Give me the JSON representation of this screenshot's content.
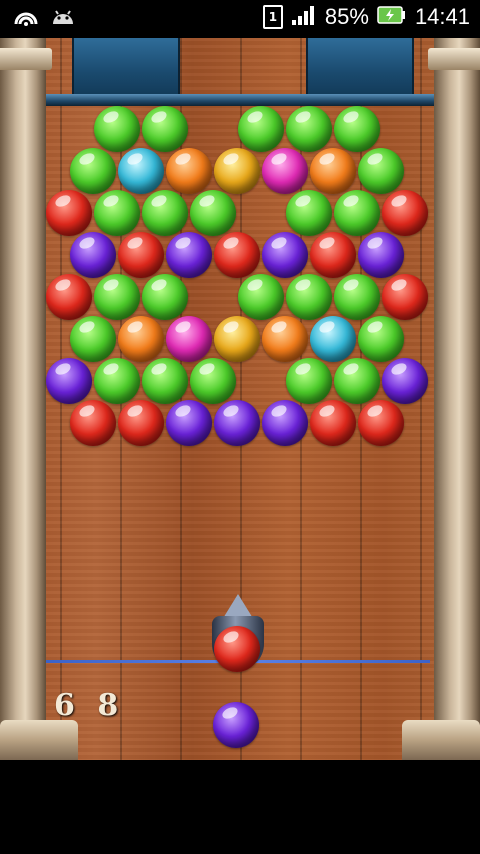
{
  "status_bar": {
    "battery_percent": "85%",
    "time": "14:41",
    "sim_label": "1",
    "icons": [
      "nfc-icon",
      "android-icon",
      "sim-icon",
      "signal-icon",
      "battery-charging-icon"
    ]
  },
  "game": {
    "score": "6 8",
    "current_bubble": "red",
    "next_bubble": "purple",
    "colors": {
      "aim_line": "#3b62c8",
      "ceiling": "#1a4a6e"
    },
    "grid": [
      {
        "row": 0,
        "cells": [
          null,
          "green",
          "green",
          null,
          "green",
          "green",
          "green",
          null
        ]
      },
      {
        "row": 1,
        "cells": [
          "green",
          "cyan",
          "orange",
          "yellow",
          "pink",
          "orange",
          "green"
        ]
      },
      {
        "row": 2,
        "cells": [
          "red",
          "green",
          "green",
          "green",
          null,
          "green",
          "green",
          "red"
        ]
      },
      {
        "row": 3,
        "cells": [
          "purple",
          "red",
          "purple",
          "red",
          "purple",
          "red",
          "purple"
        ]
      },
      {
        "row": 4,
        "cells": [
          "red",
          "green",
          "green",
          null,
          "green",
          "green",
          "green",
          "red"
        ]
      },
      {
        "row": 5,
        "cells": [
          "green",
          "orange",
          "pink",
          "yellow",
          "orange",
          "cyan",
          "green"
        ]
      },
      {
        "row": 6,
        "cells": [
          "purple",
          "green",
          "green",
          "green",
          null,
          "green",
          "green",
          "purple"
        ]
      },
      {
        "row": 7,
        "cells": [
          "red",
          "red",
          "purple",
          "purple",
          "purple",
          "red",
          "red"
        ]
      }
    ]
  }
}
